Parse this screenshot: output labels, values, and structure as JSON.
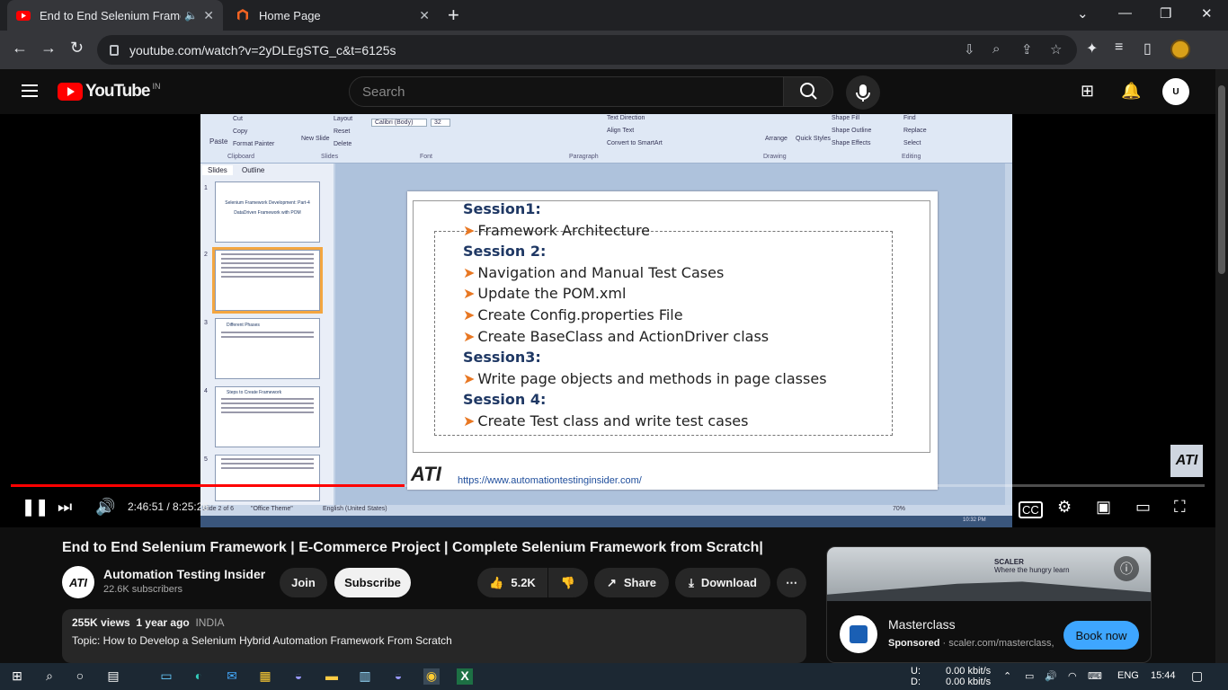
{
  "browser": {
    "tabs": [
      {
        "title": "End to End Selenium Framework | E-Commerce Project",
        "active": true
      },
      {
        "title": "Home Page",
        "active": false
      }
    ],
    "url": "youtube.com/watch?v=2yDLEgSTG_c&t=6125s"
  },
  "youtube": {
    "logo_text": "YouTube",
    "country_code": "IN",
    "search_placeholder": "Search",
    "avatar_text": "U"
  },
  "ppt": {
    "ribbon": {
      "paste": "Paste",
      "cut": "Cut",
      "copy": "Copy",
      "format_painter": "Format Painter",
      "layout": "Layout",
      "reset": "Reset",
      "delete": "Delete",
      "new_slide": "New Slide",
      "font_name": "Calibri (Body)",
      "font_size": "32",
      "text_direction": "Text Direction",
      "align_text": "Align Text",
      "convert_smartart": "Convert to SmartArt",
      "arrange": "Arrange",
      "quick_styles": "Quick Styles",
      "shape_fill": "Shape Fill",
      "shape_outline": "Shape Outline",
      "shape_effects": "Shape Effects",
      "find": "Find",
      "replace": "Replace",
      "select": "Select",
      "groups": [
        "Clipboard",
        "Slides",
        "Font",
        "Paragraph",
        "Drawing",
        "Editing"
      ]
    },
    "pane_tabs": [
      "Slides",
      "Outline"
    ],
    "thumbnails": [
      "1",
      "2",
      "3",
      "4",
      "5"
    ],
    "thumb1_title": "Selenium Framework Development: Part-4",
    "thumb1_sub": "DataDriven Framework with POM",
    "thumb3_title": "Different Phases",
    "thumb4_title": "Steps to Create Framework",
    "slide_lines": [
      {
        "text": "Session1:",
        "type": "heading"
      },
      {
        "text": "Framework Architecture",
        "type": "bullet"
      },
      {
        "text": "Session 2:",
        "type": "heading"
      },
      {
        "text": "Navigation and Manual Test Cases",
        "type": "bullet"
      },
      {
        "text": "Update the POM.xml",
        "type": "bullet"
      },
      {
        "text": "Create Config.properties File",
        "type": "bullet"
      },
      {
        "text": "Create BaseClass and ActionDriver class",
        "type": "bullet"
      },
      {
        "text": "Session3:",
        "type": "heading"
      },
      {
        "text": "Write page objects and methods in page classes",
        "type": "bullet"
      },
      {
        "text": "Session 4:",
        "type": "heading"
      },
      {
        "text": "Create Test class and write test cases",
        "type": "bullet"
      }
    ],
    "slide_url": "https://www.automationtestinginsider.com/",
    "slide_logo": "ATI",
    "status": {
      "slide": "Slide 2 of 6",
      "theme": "\"Office Theme\"",
      "lang": "English (United States)",
      "zoom": "70%"
    },
    "clock": "10:32 PM"
  },
  "player": {
    "time": "2:46:51 / 8:25:26",
    "progress_pct": 33,
    "watermark": "ATI"
  },
  "video": {
    "title": "End to End Selenium Framework | E-Commerce Project | Complete Selenium Framework from Scratch|",
    "channel": "Automation Testing Insider",
    "channel_avatar": "ATI",
    "subscribers": "22.6K subscribers",
    "join": "Join",
    "subscribe": "Subscribe",
    "likes": "5.2K",
    "share": "Share",
    "download": "Download",
    "views": "255K views",
    "ago": "1 year ago",
    "country": "INDIA",
    "topic": "Topic: How to Develop a Selenium Hybrid Automation Framework From Scratch"
  },
  "ad": {
    "brand_tag": "SCALER",
    "tagline": "Where the hungry learn",
    "name": "Masterclass",
    "sponsored": "Sponsored",
    "domain": "scaler.com/masterclass,",
    "cta": "Book now"
  },
  "tray": {
    "net_up_label": "U:",
    "net_down_label": "D:",
    "net_up": "0.00 kbit/s",
    "net_down": "0.00 kbit/s",
    "lang": "ENG",
    "time": "15:44"
  }
}
